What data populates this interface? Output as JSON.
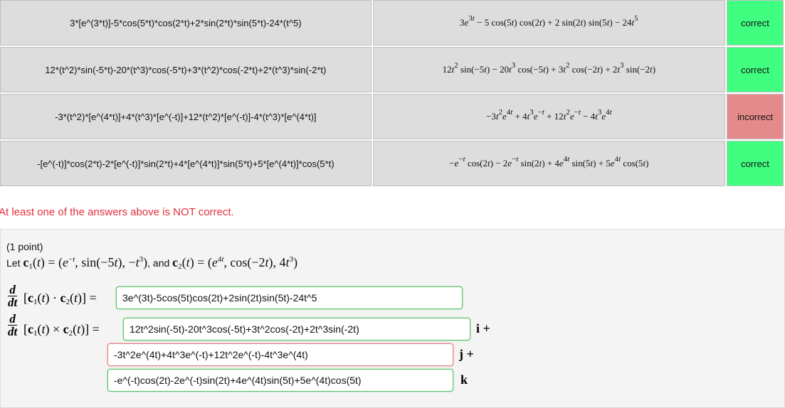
{
  "results": [
    {
      "entered": "3*[e^(3*t)]-5*cos(5*t)*cos(2*t)+2*sin(2*t)*sin(5*t)-24*(t^5)",
      "preview": "3e^{3t} − 5 cos(5t) cos(2t) + 2 sin(2t) sin(5t) − 24t^{5}",
      "status": "correct"
    },
    {
      "entered": "12*(t^2)*sin(-5*t)-20*(t^3)*cos(-5*t)+3*(t^2)*cos(-2*t)+2*(t^3)*sin(-2*t)",
      "preview": "12t^{2} sin(−5t) − 20t^{3} cos(−5t) + 3t^{2} cos(−2t) + 2t^{3} sin(−2t)",
      "status": "correct"
    },
    {
      "entered": "-3*(t^2)*[e^(4*t)]+4*(t^3)*[e^(-t)]+12*(t^2)*[e^(-t)]-4*(t^3)*[e^(4*t)]",
      "preview": "−3t^{2}e^{4t} + 4t^{3}e^{−t} + 12t^{2}e^{−t} − 4t^{3}e^{4t}",
      "status": "incorrect"
    },
    {
      "entered": "-[e^(-t)]*cos(2*t)-2*[e^(-t)]*sin(2*t)+4*[e^(4*t)]*sin(5*t)+5*[e^(4*t)]*cos(5*t)",
      "preview": "−e^{−t} cos(2t) − 2e^{−t} sin(2t) + 4e^{4t} sin(5t) + 5e^{4t} cos(5t)",
      "status": "correct"
    }
  ],
  "message": "At least one of the answers above is NOT correct.",
  "problem": {
    "points": "(1 point)",
    "let_prefix": "Let",
    "c1": "c_{1}(t) = (e^{−t}, sin(−5t), −t^{3})",
    "and": ", and",
    "c2": "c_{2}(t) = (e^{4t}, cos(−2t), 4t^{3})",
    "deriv_num": "d",
    "deriv_den": "dt",
    "dot_lhs": "[c_{1}(t) · c_{2}(t)] =",
    "cross_lhs": "[c_{1}(t) × c_{2}(t)] =",
    "answers": {
      "dot": "3e^(3t)-5cos(5t)cos(2t)+2sin(2t)sin(5t)-24t^5",
      "i": "12t^2sin(-5t)-20t^3cos(-5t)+3t^2cos(-2t)+2t^3sin(-2t)",
      "j": "-3t^2e^(4t)+4t^3e^(-t)+12t^2e^(-t)-4t^3e^(4t)",
      "k": "-e^(-t)cos(2t)-2e^(-t)sin(2t)+4e^(4t)sin(5t)+5e^(4t)cos(5t)"
    },
    "i_label": "i +",
    "j_label": "j +",
    "k_label": "k"
  },
  "colors": {
    "correct": "#40ff80",
    "incorrect": "#e48a8a",
    "message": "#e0303c"
  }
}
